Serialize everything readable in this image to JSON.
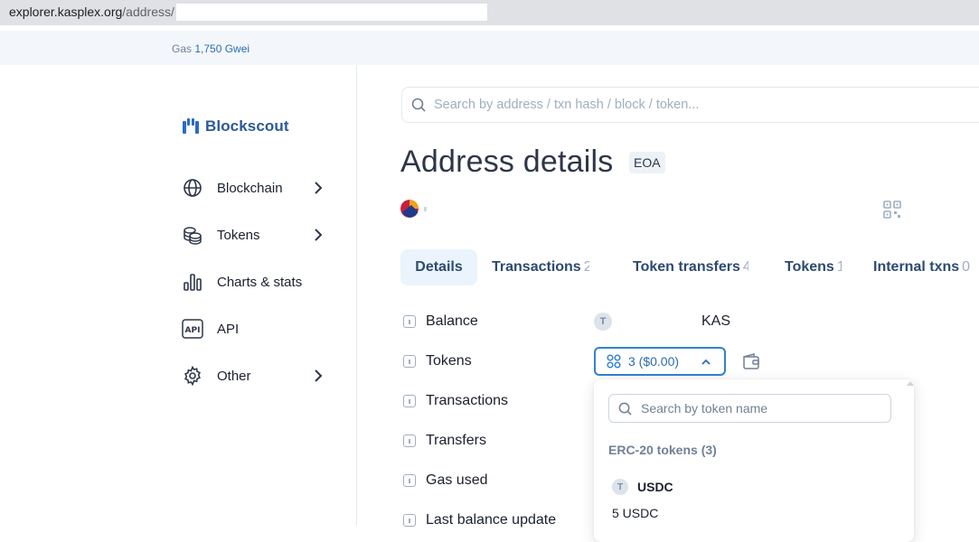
{
  "browser": {
    "url_host": "explorer.kasplex.org",
    "url_path": "/address/"
  },
  "topbar": {
    "gas_label": "Gas",
    "gas_value": "1,750 Gwei"
  },
  "sidebar": {
    "logo_text": "Blockscout",
    "items": [
      {
        "label": "Blockchain",
        "icon": "globe-icon",
        "has_submenu": true
      },
      {
        "label": "Tokens",
        "icon": "coins-icon",
        "has_submenu": true
      },
      {
        "label": "Charts & stats",
        "icon": "bar-chart-icon",
        "has_submenu": false
      },
      {
        "label": "API",
        "icon": "api-icon",
        "has_submenu": false
      },
      {
        "label": "Other",
        "icon": "gear-icon",
        "has_submenu": true
      }
    ]
  },
  "search": {
    "placeholder": "Search by address / txn hash / block / token..."
  },
  "page": {
    "title": "Address details",
    "badge": "EOA"
  },
  "tabs": [
    {
      "label": "Details",
      "count": "",
      "active": true
    },
    {
      "label": "Transactions",
      "count": "2",
      "active": false
    },
    {
      "label": "Token transfers",
      "count": "4",
      "active": false
    },
    {
      "label": "Tokens",
      "count": "1",
      "active": false
    },
    {
      "label": "Internal txns",
      "count": "0",
      "active": false
    }
  ],
  "details": {
    "rows": [
      "Balance",
      "Tokens",
      "Transactions",
      "Transfers",
      "Gas used",
      "Last balance update"
    ],
    "balance_icon_letter": "T",
    "balance_unit": "KAS",
    "tokens_button": "3 ($0.00)"
  },
  "tokens_dropdown": {
    "search_placeholder": "Search by token name",
    "group_label": "ERC-20 tokens (3)",
    "token_icon_letter": "T",
    "token_symbol": "USDC",
    "token_amount": "5 USDC"
  },
  "colors": {
    "accent": "#3182ce",
    "brand": "#2c5a97",
    "tab_active_bg": "#ebf4fc"
  }
}
